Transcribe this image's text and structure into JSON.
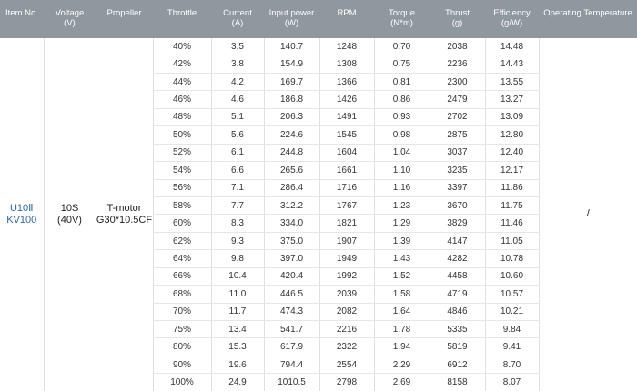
{
  "columns": [
    {
      "name": "item-no",
      "lines": [
        "Item No."
      ]
    },
    {
      "name": "voltage",
      "lines": [
        "Voltage",
        "(V)"
      ]
    },
    {
      "name": "propeller",
      "lines": [
        "Propeller"
      ]
    },
    {
      "name": "throttle",
      "lines": [
        "Throttle"
      ]
    },
    {
      "name": "current",
      "lines": [
        "Current",
        "(A)"
      ]
    },
    {
      "name": "input-power",
      "lines": [
        "Input power",
        "(W)"
      ]
    },
    {
      "name": "rpm",
      "lines": [
        "RPM"
      ]
    },
    {
      "name": "torque",
      "lines": [
        "Torque",
        "(N*m)"
      ]
    },
    {
      "name": "thrust",
      "lines": [
        "Thrust",
        "(g)"
      ]
    },
    {
      "name": "efficiency",
      "lines": [
        "Efficiency",
        "(g/W)"
      ]
    },
    {
      "name": "operating-temperature",
      "lines": [
        "Operating Temperature"
      ]
    }
  ],
  "group": {
    "item_no": [
      "U10Ⅱ",
      "KV100"
    ],
    "voltage": [
      "10S",
      "(40V)"
    ],
    "propeller": [
      "T-motor",
      "G30*10.5CF"
    ],
    "operating_temperature": "/"
  },
  "rows": [
    [
      "40%",
      "3.5",
      "140.7",
      "1248",
      "0.70",
      "2038",
      "14.48"
    ],
    [
      "42%",
      "3.8",
      "154.9",
      "1308",
      "0.75",
      "2236",
      "14.43"
    ],
    [
      "44%",
      "4.2",
      "169.7",
      "1366",
      "0.81",
      "2300",
      "13.55"
    ],
    [
      "46%",
      "4.6",
      "186.8",
      "1426",
      "0.86",
      "2479",
      "13.27"
    ],
    [
      "48%",
      "5.1",
      "206.3",
      "1491",
      "0.93",
      "2702",
      "13.09"
    ],
    [
      "50%",
      "5.6",
      "224.6",
      "1545",
      "0.98",
      "2875",
      "12.80"
    ],
    [
      "52%",
      "6.1",
      "244.8",
      "1604",
      "1.04",
      "3037",
      "12.40"
    ],
    [
      "54%",
      "6.6",
      "265.6",
      "1661",
      "1.10",
      "3235",
      "12.17"
    ],
    [
      "56%",
      "7.1",
      "286.4",
      "1716",
      "1.16",
      "3397",
      "11.86"
    ],
    [
      "58%",
      "7.7",
      "312.2",
      "1767",
      "1.23",
      "3670",
      "11.75"
    ],
    [
      "60%",
      "8.3",
      "334.0",
      "1821",
      "1.29",
      "3829",
      "11.46"
    ],
    [
      "62%",
      "9.3",
      "375.0",
      "1907",
      "1.39",
      "4147",
      "11.05"
    ],
    [
      "64%",
      "9.8",
      "397.0",
      "1949",
      "1.43",
      "4282",
      "10.78"
    ],
    [
      "66%",
      "10.4",
      "420.4",
      "1992",
      "1.52",
      "4458",
      "10.60"
    ],
    [
      "68%",
      "11.0",
      "446.5",
      "2039",
      "1.58",
      "4719",
      "10.57"
    ],
    [
      "70%",
      "11.7",
      "474.3",
      "2082",
      "1.64",
      "4846",
      "10.21"
    ],
    [
      "75%",
      "13.4",
      "541.7",
      "2216",
      "1.78",
      "5335",
      "9.84"
    ],
    [
      "80%",
      "15.3",
      "617.9",
      "2322",
      "1.94",
      "5819",
      "9.41"
    ],
    [
      "90%",
      "19.6",
      "794.4",
      "2554",
      "2.29",
      "6912",
      "8.70"
    ],
    [
      "100%",
      "24.9",
      "1010.5",
      "2798",
      "2.69",
      "8158",
      "8.07"
    ]
  ]
}
